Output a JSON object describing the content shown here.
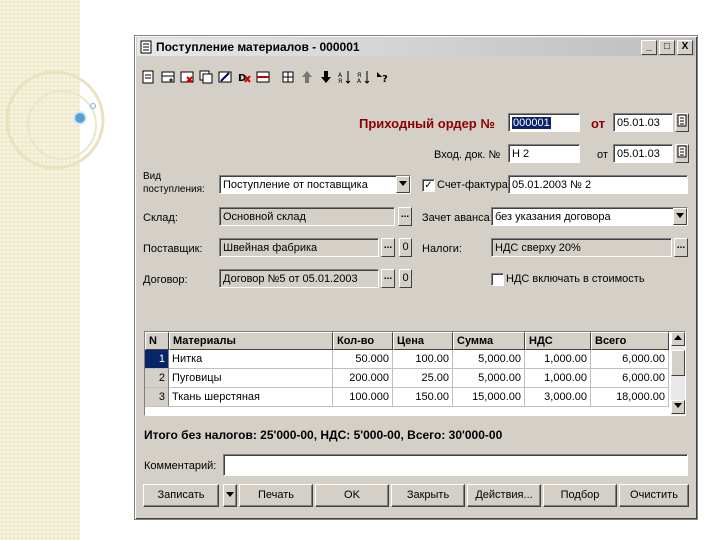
{
  "window": {
    "title": "Поступление материалов - 000001",
    "controls": [
      "_",
      "□",
      "X"
    ]
  },
  "toolbar": {
    "icons": [
      "new-doc-icon",
      "add-row-icon",
      "delete-row-icon",
      "copy-row-icon",
      "edit-row-icon",
      "delete-mark-icon",
      "insert-icon",
      "move-up-icon",
      "move-down-icon",
      "sort-asc-icon",
      "sort-desc-icon",
      "help-icon"
    ]
  },
  "header": {
    "order_title": "Приходный ордер №",
    "order_number": "000001",
    "from_label": "от",
    "order_date": "05.01.03",
    "incoming_doc_label": "Вход. док. №",
    "incoming_doc_number": "Н 2",
    "incoming_from_label": "от",
    "incoming_date": "05.01.03"
  },
  "form": {
    "receipt_type_label": "Вид поступления:",
    "receipt_type_value": "Поступление от поставщика",
    "invoice_checkbox_checked": "✓",
    "invoice_label": "Счет-фактура:",
    "invoice_value": "05.01.2003 № 2",
    "warehouse_label": "Склад:",
    "warehouse_value": "Основной склад",
    "advance_label": "Зачет аванса:",
    "advance_value": "без указания договора",
    "supplier_label": "Поставщик:",
    "supplier_value": "Швейная фабрика",
    "taxes_label": "Налоги:",
    "taxes_value": "НДС сверху 20%",
    "contract_label": "Договор:",
    "contract_value": "Договор №5 от 05.01.2003",
    "vat_include_label": "НДС включать в стоимость",
    "o_button": "0",
    "dots": "..."
  },
  "table": {
    "columns": [
      "N",
      "Материалы",
      "Кол-во",
      "Цена",
      "Сумма",
      "НДС",
      "Всего"
    ],
    "rows": [
      [
        "1",
        "Нитка",
        "50.000",
        "100.00",
        "5,000.00",
        "1,000.00",
        "6,000.00"
      ],
      [
        "2",
        "Пуговицы",
        "200.000",
        "25.00",
        "5,000.00",
        "1,000.00",
        "6,000.00"
      ],
      [
        "3",
        "Ткань шерстяная",
        "100.000",
        "150.00",
        "15,000.00",
        "3,000.00",
        "18,000.00"
      ]
    ]
  },
  "totals": "Итого без налогов: 25'000-00, НДС: 5'000-00, Всего: 30'000-00",
  "comment": {
    "label": "Комментарий:",
    "value": ""
  },
  "buttons": {
    "save": "Записать",
    "print": "Печать",
    "ok": "OK",
    "close": "Закрыть",
    "actions": "Действия...",
    "selection": "Подбор",
    "clear": "Очистить"
  }
}
